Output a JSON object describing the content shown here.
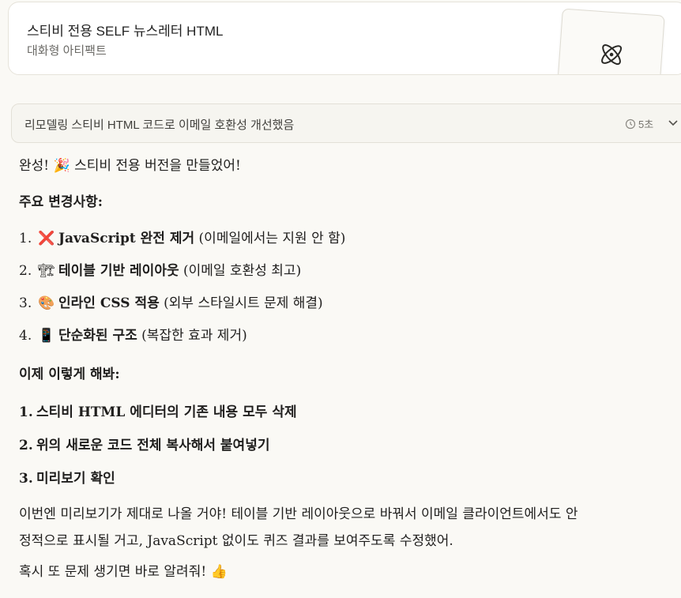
{
  "artifact": {
    "title": "스티비 전용 SELF 뉴스레터 HTML",
    "subtitle": "대화형 아티팩트",
    "icon": "atom-icon"
  },
  "thinking": {
    "label": "리모델링 스티비 HTML 코드로 이메일 호환성 개선했음",
    "duration": "5초"
  },
  "message": {
    "intro_prefix": "완성! ",
    "intro_emoji": "🎉",
    "intro_text": " 스티비 전용 버전을 만들었어!",
    "changes_heading": "주요 변경사항:",
    "changes": [
      {
        "num": "1.",
        "emoji": "❌",
        "bold": "JavaScript 완전 제거",
        "note": " (이메일에서는 지원 안 함)"
      },
      {
        "num": "2.",
        "emoji": "🏗",
        "bold": "테이블 기반 레이아웃",
        "note": " (이메일 호환성 최고)"
      },
      {
        "num": "3.",
        "emoji": "🎨",
        "bold": "인라인 CSS 적용",
        "note": " (외부 스타일시트 문제 해결)"
      },
      {
        "num": "4.",
        "emoji": "📱",
        "bold": "단순화된 구조",
        "note": " (복잡한 효과 제거)"
      }
    ],
    "steps_heading": "이제 이렇게 해봐:",
    "steps": [
      {
        "num": "1.",
        "text": "스티비 HTML 에디터의 기존 내용 모두 삭제"
      },
      {
        "num": "2.",
        "text": "위의 새로운 코드 전체 복사해서 붙여넣기"
      },
      {
        "num": "3.",
        "text": "미리보기 확인"
      }
    ],
    "closing_line1": "이번엔 미리보기가 제대로 나올 거야! 테이블 기반 레이아웃으로 바꿔서 이메일 클라이언트에서도 안",
    "closing_line2": "정적으로 표시될 거고, JavaScript 없이도 퀴즈 결과를 보여주도록 수정했어.",
    "final_text": "혹시 또 문제 생기면 바로 알려줘! ",
    "final_emoji": "👍"
  }
}
